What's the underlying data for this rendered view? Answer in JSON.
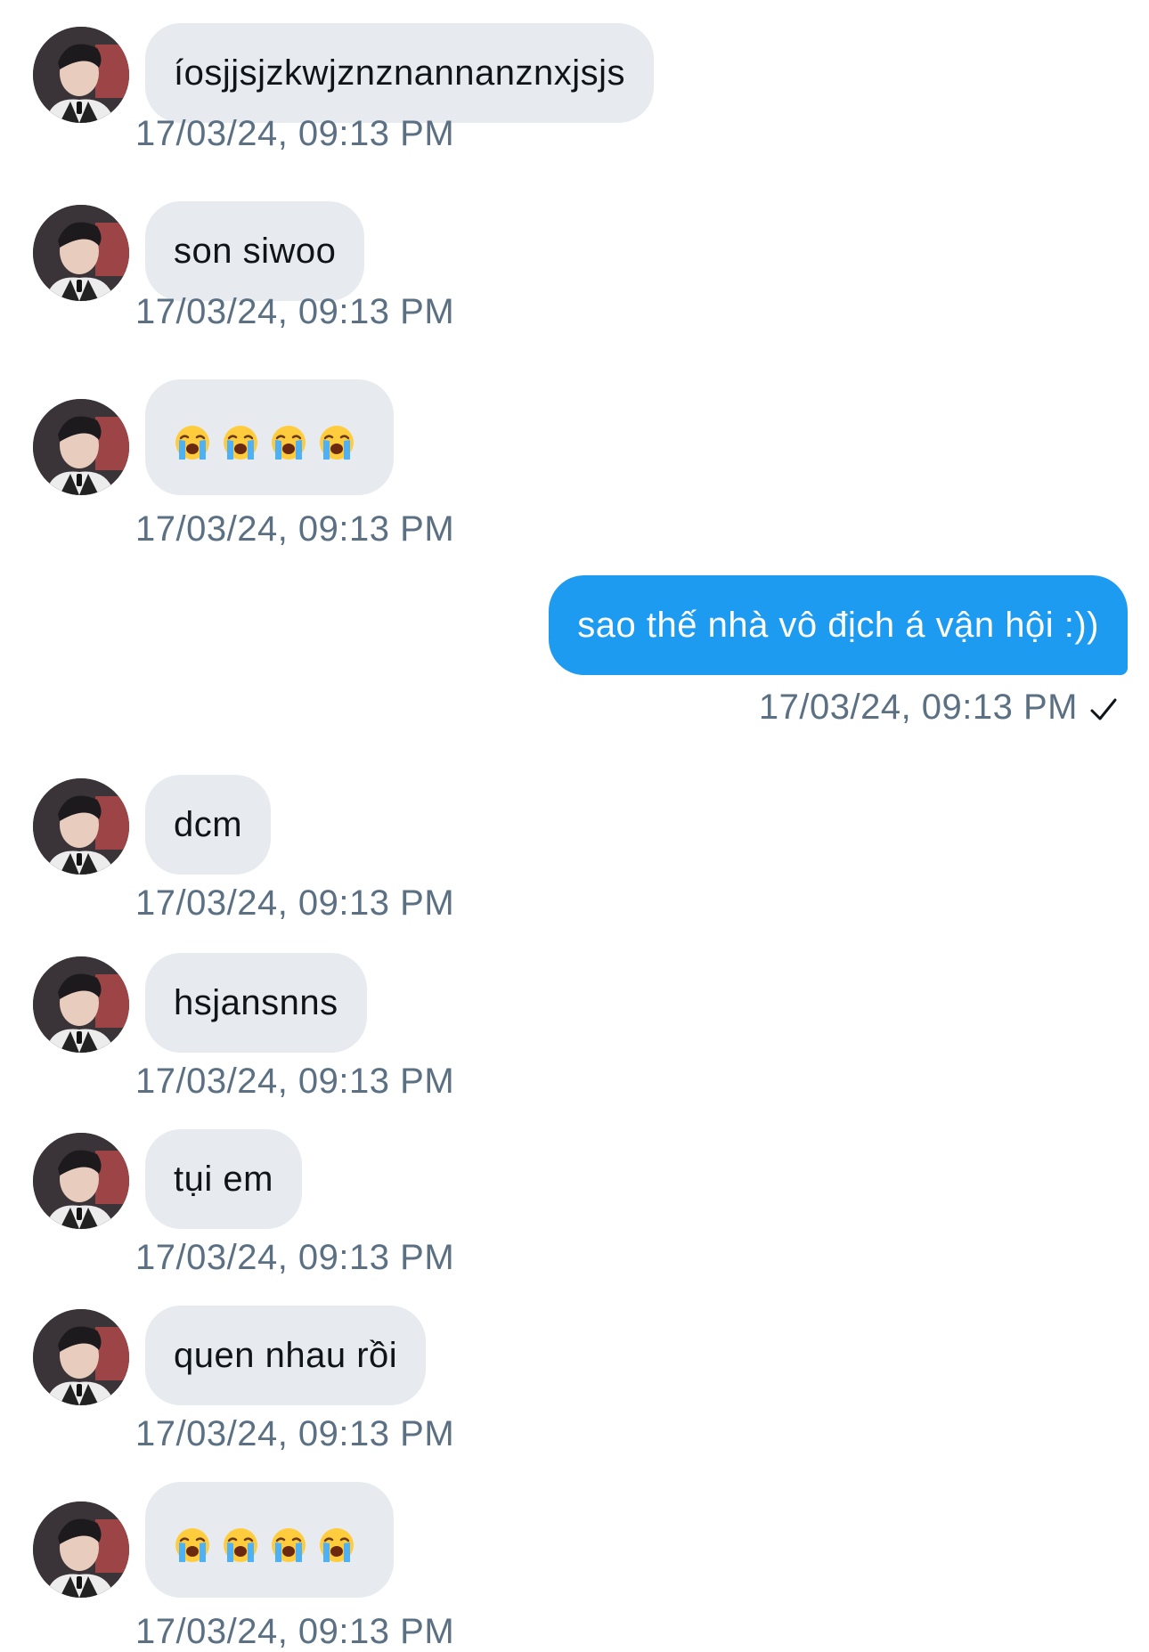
{
  "messages": [
    {
      "side": "in",
      "text": "íosjjsjzkwjznznannanznxjsjs",
      "time": "17/03/24, 09:13 PM"
    },
    {
      "side": "in",
      "text": "son siwoo",
      "time": "17/03/24, 09:13 PM"
    },
    {
      "side": "in",
      "emoji": "loudly-crying-face",
      "count": 4,
      "time": "17/03/24, 09:13 PM"
    },
    {
      "side": "out",
      "text": "sao thế nhà vô địch á vận hội :))",
      "time": "17/03/24, 09:13 PM",
      "status": "check-icon"
    },
    {
      "side": "in",
      "text": "dcm",
      "time": "17/03/24, 09:13 PM"
    },
    {
      "side": "in",
      "text": "hsjansnns",
      "time": "17/03/24, 09:13 PM"
    },
    {
      "side": "in",
      "text": "tụi em",
      "time": "17/03/24, 09:13 PM"
    },
    {
      "side": "in",
      "text": "quen nhau rồi",
      "time": "17/03/24, 09:13 PM"
    },
    {
      "side": "in",
      "emoji": "loudly-crying-face",
      "count": 4,
      "time": "17/03/24, 09:13 PM"
    }
  ],
  "colors": {
    "incoming_bubble": "#e7ebef",
    "outgoing_bubble": "#1d9bf0",
    "timestamp": "#5b7083",
    "text": "#0f1419"
  }
}
